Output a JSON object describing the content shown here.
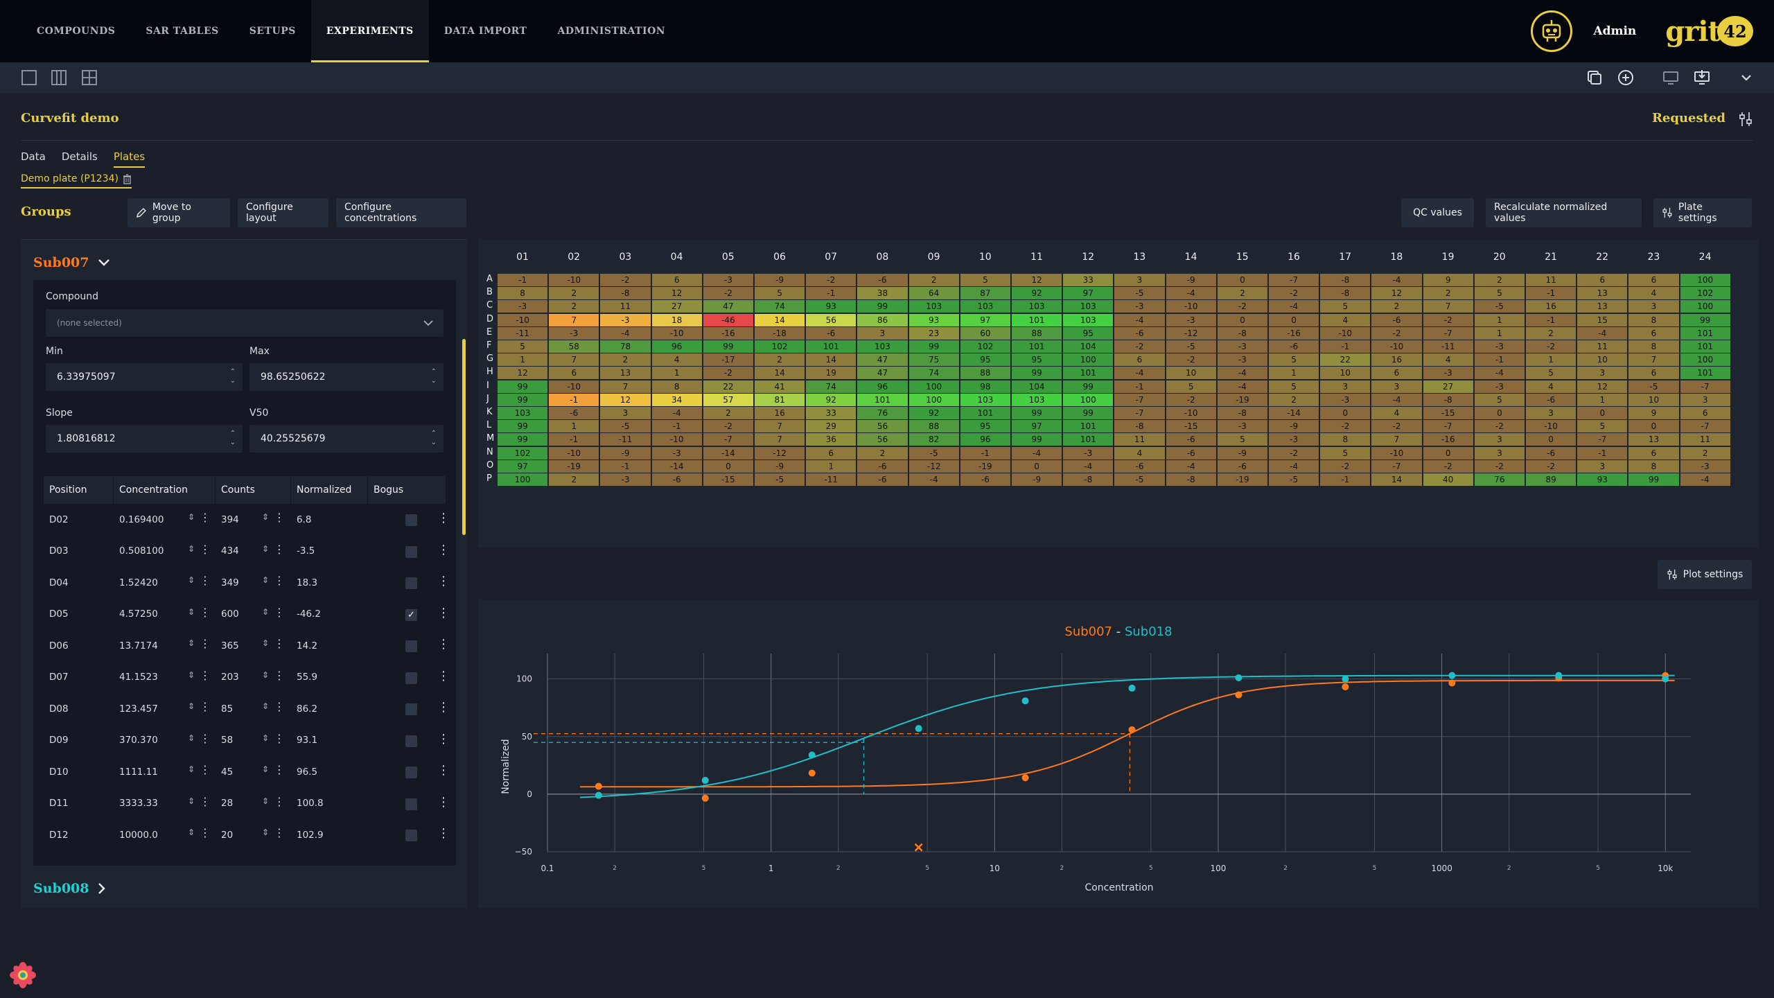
{
  "nav": {
    "items": [
      "COMPOUNDS",
      "SAR TABLES",
      "SETUPS",
      "EXPERIMENTS",
      "DATA IMPORT",
      "ADMINISTRATION"
    ],
    "active": "EXPERIMENTS",
    "user_name": "Admin",
    "logo_text": "grit",
    "logo_number": "42"
  },
  "experiment": {
    "title": "Curvefit demo",
    "status": "Requested",
    "tabs": [
      "Data",
      "Details",
      "Plates"
    ],
    "active_tab": "Plates",
    "plate_tab": "Demo plate (P1234)"
  },
  "groups": {
    "label": "Groups",
    "buttons": {
      "move_to_group": "Move to group",
      "configure_layout": "Configure layout",
      "configure_concentrations": "Configure concentrations",
      "qc_values": "QC values",
      "recalculate": "Recalculate normalized values",
      "plate_settings": "Plate settings",
      "plot_settings": "Plot settings"
    },
    "open_group": {
      "name": "Sub007",
      "color": "#ff7a1a",
      "compound_label": "Compound",
      "compound_placeholder": "(none selected)",
      "min_label": "Min",
      "min_value": "6.33975097",
      "max_label": "Max",
      "max_value": "98.65250622",
      "slope_label": "Slope",
      "slope_value": "1.80816812",
      "v50_label": "V50",
      "v50_value": "40.25525679",
      "table": {
        "headers": [
          "Position",
          "Concentration",
          "Counts",
          "Normalized",
          "Bogus"
        ],
        "rows": [
          {
            "position": "D02",
            "concentration": "0.169400",
            "counts": "394",
            "normalized": "6.8",
            "bogus": false
          },
          {
            "position": "D03",
            "concentration": "0.508100",
            "counts": "434",
            "normalized": "-3.5",
            "bogus": false
          },
          {
            "position": "D04",
            "concentration": "1.52420",
            "counts": "349",
            "normalized": "18.3",
            "bogus": false
          },
          {
            "position": "D05",
            "concentration": "4.57250",
            "counts": "600",
            "normalized": "-46.2",
            "bogus": true
          },
          {
            "position": "D06",
            "concentration": "13.7174",
            "counts": "365",
            "normalized": "14.2",
            "bogus": false
          },
          {
            "position": "D07",
            "concentration": "41.1523",
            "counts": "203",
            "normalized": "55.9",
            "bogus": false
          },
          {
            "position": "D08",
            "concentration": "123.457",
            "counts": "85",
            "normalized": "86.2",
            "bogus": false
          },
          {
            "position": "D09",
            "concentration": "370.370",
            "counts": "58",
            "normalized": "93.1",
            "bogus": false
          },
          {
            "position": "D10",
            "concentration": "1111.11",
            "counts": "45",
            "normalized": "96.5",
            "bogus": false
          },
          {
            "position": "D11",
            "concentration": "3333.33",
            "counts": "28",
            "normalized": "100.8",
            "bogus": false
          },
          {
            "position": "D12",
            "concentration": "10000.0",
            "counts": "20",
            "normalized": "102.9",
            "bogus": false
          }
        ]
      }
    },
    "collapsed_group": {
      "name": "Sub008",
      "color": "#1fd2d2"
    }
  },
  "heatmap": {
    "columns": [
      "01",
      "02",
      "03",
      "04",
      "05",
      "06",
      "07",
      "08",
      "09",
      "10",
      "11",
      "12",
      "13",
      "14",
      "15",
      "16",
      "17",
      "18",
      "19",
      "20",
      "21",
      "22",
      "23",
      "24"
    ],
    "rows": [
      "A",
      "B",
      "C",
      "D",
      "E",
      "F",
      "G",
      "H",
      "I",
      "J",
      "K",
      "L",
      "M",
      "N",
      "O",
      "P"
    ],
    "values": [
      [
        -1,
        -10,
        -2,
        6,
        -3,
        -9,
        -2,
        -6,
        2,
        5,
        12,
        33,
        3,
        -9,
        0,
        -7,
        -8,
        -4,
        9,
        2,
        11,
        6,
        6,
        100
      ],
      [
        8,
        2,
        -8,
        12,
        -2,
        5,
        -1,
        38,
        64,
        87,
        92,
        97,
        -5,
        -4,
        2,
        -2,
        -8,
        12,
        2,
        5,
        -1,
        13,
        4,
        102
      ],
      [
        -3,
        2,
        11,
        27,
        47,
        74,
        93,
        99,
        103,
        103,
        103,
        103,
        -3,
        -10,
        -2,
        -4,
        5,
        2,
        7,
        -5,
        16,
        13,
        3,
        100
      ],
      [
        -10,
        7,
        -3,
        18,
        -46,
        14,
        56,
        86,
        93,
        97,
        101,
        103,
        -4,
        -3,
        0,
        0,
        4,
        -6,
        -2,
        1,
        -1,
        15,
        8,
        99
      ],
      [
        -11,
        -3,
        -4,
        -10,
        -16,
        -18,
        -6,
        3,
        23,
        60,
        88,
        95,
        -6,
        -12,
        -8,
        -16,
        -10,
        -2,
        -7,
        1,
        2,
        -4,
        6,
        101
      ],
      [
        5,
        58,
        78,
        96,
        99,
        102,
        101,
        103,
        99,
        102,
        101,
        104,
        -2,
        -5,
        -3,
        -6,
        -1,
        -10,
        -11,
        -3,
        -2,
        11,
        8,
        101
      ],
      [
        1,
        7,
        2,
        4,
        -17,
        2,
        14,
        47,
        75,
        95,
        95,
        100,
        6,
        -2,
        -3,
        5,
        22,
        16,
        4,
        -1,
        1,
        10,
        7,
        100
      ],
      [
        12,
        6,
        13,
        1,
        -2,
        14,
        19,
        47,
        74,
        88,
        99,
        101,
        -4,
        10,
        -4,
        1,
        10,
        6,
        -3,
        -4,
        5,
        3,
        6,
        101
      ],
      [
        99,
        -10,
        7,
        8,
        22,
        41,
        74,
        96,
        100,
        98,
        104,
        99,
        -1,
        5,
        -4,
        5,
        3,
        3,
        27,
        -3,
        4,
        12,
        -5,
        -7
      ],
      [
        99,
        -1,
        12,
        34,
        57,
        81,
        92,
        101,
        100,
        103,
        103,
        100,
        -7,
        -2,
        -19,
        2,
        -3,
        -4,
        -8,
        5,
        -6,
        1,
        10,
        3
      ],
      [
        103,
        -6,
        3,
        -4,
        2,
        16,
        33,
        76,
        92,
        101,
        99,
        99,
        -7,
        -10,
        -8,
        -14,
        0,
        4,
        -15,
        0,
        3,
        0,
        9,
        6
      ],
      [
        99,
        1,
        -5,
        -1,
        -2,
        7,
        29,
        56,
        88,
        95,
        97,
        101,
        -8,
        -15,
        -3,
        -9,
        -2,
        -2,
        -7,
        -2,
        -10,
        5,
        0,
        -7
      ],
      [
        99,
        -1,
        -11,
        -10,
        -7,
        7,
        36,
        56,
        82,
        96,
        99,
        101,
        11,
        -6,
        5,
        -3,
        8,
        7,
        -16,
        3,
        0,
        -7,
        13,
        11
      ],
      [
        102,
        -10,
        -9,
        -3,
        -14,
        -12,
        6,
        2,
        -5,
        -1,
        -4,
        -3,
        4,
        -6,
        -9,
        -2,
        5,
        -10,
        0,
        3,
        -6,
        -1,
        6,
        2
      ],
      [
        97,
        -19,
        -1,
        -14,
        0,
        -9,
        1,
        -6,
        -12,
        -19,
        0,
        -4,
        -6,
        -4,
        -6,
        -4,
        -2,
        -7,
        -2,
        -2,
        -2,
        3,
        8,
        -3
      ],
      [
        100,
        2,
        -3,
        -6,
        -15,
        -5,
        -11,
        -6,
        -4,
        -6,
        -9,
        -8,
        -5,
        -8,
        -19,
        -5,
        -1,
        14,
        40,
        76,
        89,
        93,
        99,
        -4
      ]
    ]
  },
  "plot": {
    "title_part1": "Sub007",
    "title_sep": " - ",
    "title_part2": "Sub018",
    "color1": "#ff7a1a",
    "color2": "#1fc0c8",
    "xlabel": "Concentration",
    "ylabel": "Normalized",
    "x_tick_labels": [
      "0.1",
      "1",
      "10",
      "100",
      "1000",
      "10k"
    ],
    "x_minor_labels": [
      "2",
      "5"
    ],
    "y_tick_labels": [
      "100",
      "50",
      "0",
      "−50"
    ],
    "chart_data": {
      "type": "scatter",
      "x_scale": "log",
      "xlim": [
        0.1,
        13000
      ],
      "ylim": [
        -50,
        110
      ],
      "series": [
        {
          "name": "Sub007",
          "color": "#ff7a1a",
          "points": [
            [
              0.1694,
              6.8
            ],
            [
              0.5081,
              -3.5
            ],
            [
              1.5242,
              18.3
            ],
            [
              13.7174,
              14.2
            ],
            [
              41.1523,
              55.9
            ],
            [
              123.457,
              86.2
            ],
            [
              370.37,
              93.1
            ],
            [
              1111.11,
              96.5
            ],
            [
              3333.33,
              100.8
            ],
            [
              10000,
              102.9
            ]
          ],
          "excluded_points": [
            [
              4.5725,
              -46.2
            ]
          ],
          "fit": {
            "min": 6.33975097,
            "max": 98.65250622,
            "slope": 1.80816812,
            "v50": 40.25525679
          }
        },
        {
          "name": "Sub018",
          "color": "#1fc0c8",
          "points": [
            [
              0.1694,
              -1
            ],
            [
              0.5081,
              12
            ],
            [
              1.5242,
              34
            ],
            [
              4.5725,
              57
            ],
            [
              13.7174,
              81
            ],
            [
              41.1523,
              92
            ],
            [
              123.457,
              101
            ],
            [
              370.37,
              100
            ],
            [
              1111.11,
              103
            ],
            [
              3333.33,
              103
            ],
            [
              10000,
              100
            ]
          ],
          "fit": {
            "min": -6,
            "max": 103,
            "slope": 1.2,
            "v50": 2.6
          }
        }
      ]
    }
  },
  "icons": {
    "nav_avatar": "robot-avatar-icon",
    "toolbar": [
      "single-panel-icon",
      "three-columns-icon",
      "grid-icon",
      "copy-icon",
      "add-circle-icon",
      "monitor-icon",
      "monitor-download-icon",
      "chevron-down-icon"
    ],
    "status": "settings-sliders-icon",
    "react": "react-devtools-icon"
  }
}
